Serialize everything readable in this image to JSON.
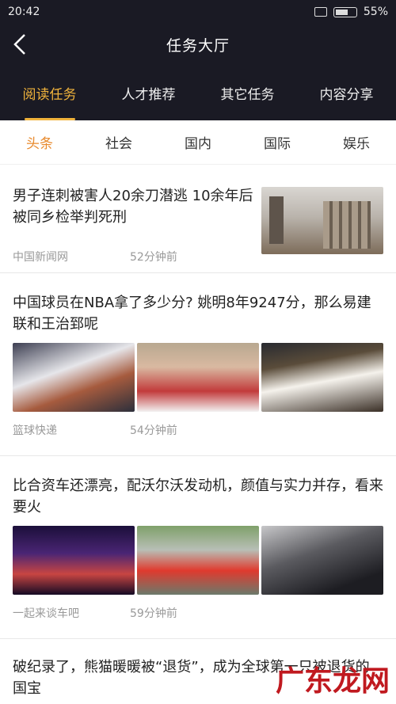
{
  "status": {
    "time": "20:42",
    "battery": "55%"
  },
  "title": "任务大厅",
  "tabs": [
    {
      "label": "阅读任务",
      "active": true
    },
    {
      "label": "人才推荐",
      "active": false
    },
    {
      "label": "其它任务",
      "active": false
    },
    {
      "label": "内容分享",
      "active": false
    }
  ],
  "subtabs": [
    {
      "label": "头条",
      "active": true
    },
    {
      "label": "社会",
      "active": false
    },
    {
      "label": "国内",
      "active": false
    },
    {
      "label": "国际",
      "active": false
    },
    {
      "label": "娱乐",
      "active": false
    }
  ],
  "articles": [
    {
      "headline": "男子连刺被害人20余刀潜逃 10余年后被同乡检举判死刑",
      "source": "中国新闻网",
      "time": "52分钟前"
    },
    {
      "headline": "中国球员在NBA拿了多少分? 姚明8年9247分，那么易建联和王治郅呢",
      "source": "篮球快递",
      "time": "54分钟前"
    },
    {
      "headline": "比合资车还漂亮，配沃尔沃发动机，颜值与实力并存，看来要火",
      "source": "一起来谈车吧",
      "time": "59分钟前"
    },
    {
      "headline": "破纪录了，熊猫暖暖被“退货”，成为全球第一只被退货的国宝"
    }
  ],
  "watermark": "广东龙网",
  "colors": {
    "header_bg": "#1a1a24",
    "accent": "#f0b33c",
    "subtab_active": "#e88a2e"
  }
}
